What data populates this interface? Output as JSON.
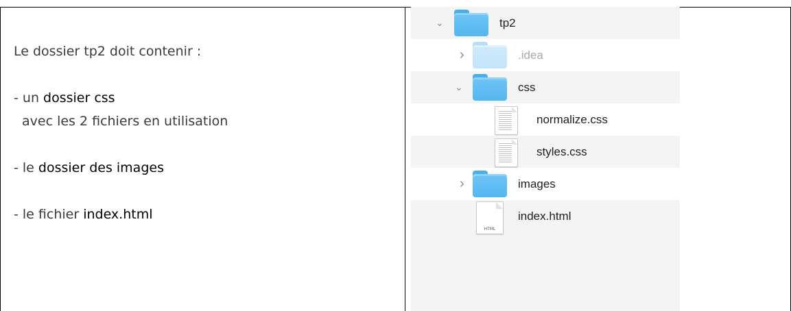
{
  "left_cell": {
    "intro": "Le dossier tp2 doit contenir :",
    "item1_prefix": "- un ",
    "item1_bold": "dossier css",
    "item1_sub": "avec les 2 fichiers en utilisation",
    "item2_prefix": "- le ",
    "item2_bold": "dossier des images",
    "item3_prefix": "- le fichier ",
    "item3_bold": "index.html"
  },
  "finder": {
    "rows": [
      {
        "name": "tp2",
        "expanded": true,
        "icon": "folder-icon"
      },
      {
        "name": ".idea",
        "expanded": false,
        "icon": "folder-icon",
        "hidden": true
      },
      {
        "name": "css",
        "expanded": true,
        "icon": "folder-icon"
      },
      {
        "name": "normalize.css",
        "icon": "text-file-icon"
      },
      {
        "name": "styles.css",
        "icon": "text-file-icon"
      },
      {
        "name": "images",
        "expanded": false,
        "icon": "folder-icon"
      },
      {
        "name": "index.html",
        "icon": "html-file-icon",
        "badge": "HTML"
      }
    ],
    "chevron_expanded": "⌄",
    "chevron_collapsed": "›"
  },
  "colors": {
    "folder": "#55b6f0",
    "folder_faded": "#c2e4fa",
    "stripe": "#f4f4f4"
  }
}
